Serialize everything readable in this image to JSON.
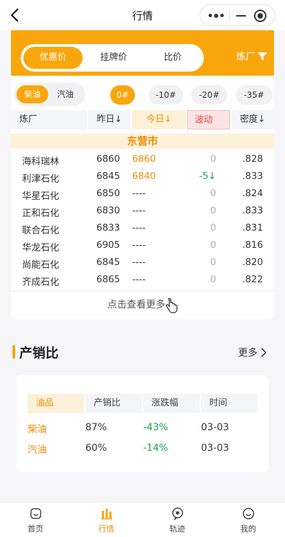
{
  "nav": {
    "title": "行情"
  },
  "price_tabs": {
    "items": [
      "优惠价",
      "挂牌价",
      "比价"
    ],
    "active": 0
  },
  "refinery_filter": {
    "label": "炼厂"
  },
  "fuel_toggle": {
    "items": [
      "柴油",
      "汽油"
    ],
    "active": 0
  },
  "grades": {
    "items": [
      "0#",
      "-10#",
      "-20#",
      "-35#"
    ],
    "active": 0
  },
  "table_header": {
    "refinery": "炼厂",
    "yesterday": "昨日↓",
    "today": "今日↓",
    "change": "波动",
    "density": "密度↓"
  },
  "city": "东营市",
  "rows": [
    {
      "name": "海科瑞林",
      "yesterday": "6860",
      "today": "6860",
      "change": "0",
      "density": ".828"
    },
    {
      "name": "利津石化",
      "yesterday": "6845",
      "today": "6840",
      "change": "-5↓",
      "density": ".833"
    },
    {
      "name": "华星石化",
      "yesterday": "6850",
      "today": "----",
      "change": "0",
      "density": ".824"
    },
    {
      "name": "正和石化",
      "yesterday": "6830",
      "today": "----",
      "change": "0",
      "density": ".833"
    },
    {
      "name": "联合石化",
      "yesterday": "6833",
      "today": "----",
      "change": "0",
      "density": ".831"
    },
    {
      "name": "华龙石化",
      "yesterday": "6905",
      "today": "----",
      "change": "0",
      "density": ".816"
    },
    {
      "name": "尚能石化",
      "yesterday": "6845",
      "today": "----",
      "change": "0",
      "density": ".820"
    },
    {
      "name": "齐成石化",
      "yesterday": "6865",
      "today": "----",
      "change": "0",
      "density": ".822"
    }
  ],
  "view_more": "点击查看更多",
  "ratio_section": {
    "title": "产销比",
    "more": "更多",
    "headers": [
      "油品",
      "产销比",
      "涨跌幅",
      "时间"
    ],
    "rows": [
      {
        "product": "柴油",
        "ratio": "87%",
        "change": "-43%",
        "date": "03-03"
      },
      {
        "product": "汽油",
        "ratio": "60%",
        "change": "-14%",
        "date": "03-03"
      }
    ]
  },
  "tabbar": {
    "items": [
      "首页",
      "行情",
      "轨迹",
      "我的"
    ],
    "active": 1
  },
  "colors": {
    "accent": "#f8a60c",
    "accent_text": "#f08c00",
    "down": "#1aa34a"
  }
}
